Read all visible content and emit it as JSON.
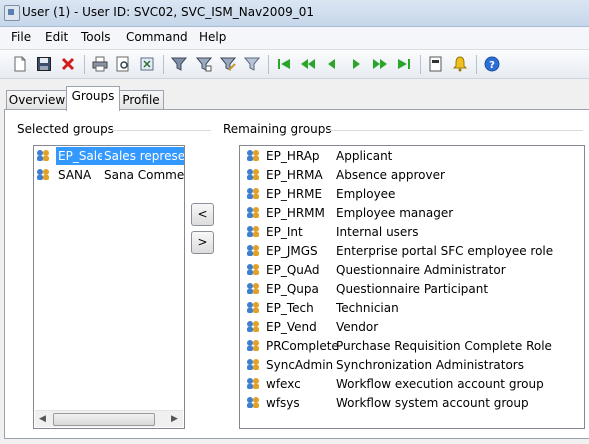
{
  "window": {
    "title": "User (1) - User ID: SVC02, SVC_ISM_Nav2009_01"
  },
  "menu": [
    "File",
    "Edit",
    "Tools",
    "Command",
    "Help"
  ],
  "toolbar": {
    "icons": [
      "new-icon",
      "save-icon",
      "delete-icon",
      "print-icon",
      "print-preview-icon",
      "export-icon",
      "filter-icon",
      "filter-by-selection-icon",
      "advanced-filter-icon",
      "remove-filter-icon",
      "first-record-icon",
      "previous-page-icon",
      "previous-record-icon",
      "next-record-icon",
      "next-page-icon",
      "last-record-icon",
      "document-icon",
      "alert-icon",
      "help-icon"
    ]
  },
  "tabs": [
    {
      "label": "Overview",
      "active": false
    },
    {
      "label": "Groups",
      "active": true
    },
    {
      "label": "Profile",
      "active": false
    }
  ],
  "selected_groups": {
    "label": "Selected groups",
    "items": [
      {
        "code": "EP_Sale",
        "desc": "Sales represent",
        "selected": true
      },
      {
        "code": "SANA",
        "desc": "Sana Commerc",
        "selected": false
      }
    ]
  },
  "remaining_groups": {
    "label": "Remaining groups",
    "items": [
      {
        "code": "EP_HRAp",
        "desc": "Applicant"
      },
      {
        "code": "EP_HRMA",
        "desc": "Absence approver"
      },
      {
        "code": "EP_HRME",
        "desc": "Employee"
      },
      {
        "code": "EP_HRMM",
        "desc": "Employee manager"
      },
      {
        "code": "EP_Int",
        "desc": "Internal users"
      },
      {
        "code": "EP_JMGS",
        "desc": "Enterprise portal SFC employee role"
      },
      {
        "code": "EP_QuAd",
        "desc": "Questionnaire Administrator"
      },
      {
        "code": "EP_Qupa",
        "desc": "Questionnaire Participant"
      },
      {
        "code": "EP_Tech",
        "desc": "Technician"
      },
      {
        "code": "EP_Vend",
        "desc": "Vendor"
      },
      {
        "code": "PRComplete",
        "desc": "Purchase Requisition Complete Role"
      },
      {
        "code": "SyncAdmin",
        "desc": "Synchronization Administrators"
      },
      {
        "code": "wfexc",
        "desc": "Workflow execution account group"
      },
      {
        "code": "wfsys",
        "desc": "Workflow system account group"
      }
    ]
  },
  "buttons": {
    "remove": "<",
    "add": ">"
  }
}
